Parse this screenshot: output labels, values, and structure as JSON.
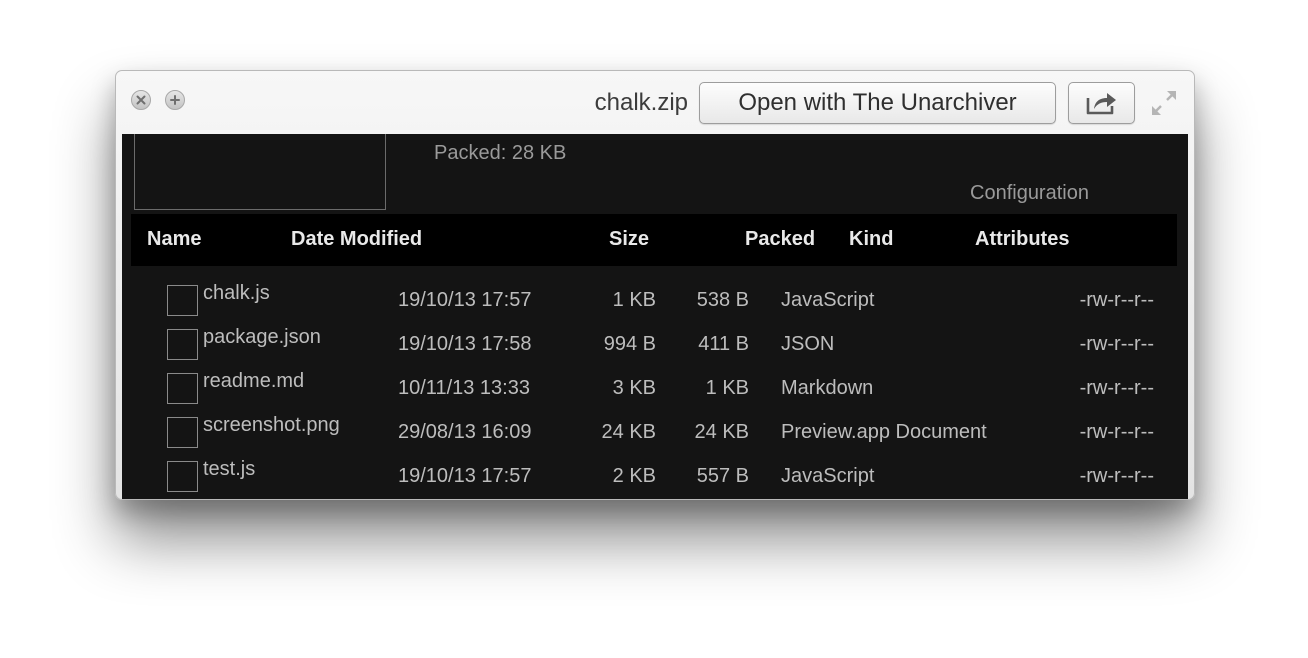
{
  "window": {
    "title": "chalk.zip",
    "open_button_label": "Open with The Unarchiver"
  },
  "icons": {
    "close": "close-icon",
    "zoom": "plus-icon",
    "share": "share-icon",
    "fullscreen": "fullscreen-expand-icon"
  },
  "summary": {
    "packed": "Packed: 28 KB",
    "configuration": "Configuration"
  },
  "table": {
    "headers": {
      "name": "Name",
      "date_modified": "Date Modified",
      "size": "Size",
      "packed": "Packed",
      "kind": "Kind",
      "attributes": "Attributes"
    },
    "rows": [
      {
        "name": "chalk.js",
        "date": "19/10/13 17:57",
        "size": "1 KB",
        "packed": "538 B",
        "kind": "JavaScript",
        "attr": "-rw-r--r--"
      },
      {
        "name": "package.json",
        "date": "19/10/13 17:58",
        "size": "994 B",
        "packed": "411 B",
        "kind": "JSON",
        "attr": "-rw-r--r--"
      },
      {
        "name": "readme.md",
        "date": "10/11/13 13:33",
        "size": "3 KB",
        "packed": "1 KB",
        "kind": "Markdown",
        "attr": "-rw-r--r--"
      },
      {
        "name": "screenshot.png",
        "date": "29/08/13 16:09",
        "size": "24 KB",
        "packed": "24 KB",
        "kind": "Preview.app Document",
        "attr": "-rw-r--r--"
      },
      {
        "name": "test.js",
        "date": "19/10/13 17:57",
        "size": "2 KB",
        "packed": "557 B",
        "kind": "JavaScript",
        "attr": "-rw-r--r--"
      }
    ]
  }
}
